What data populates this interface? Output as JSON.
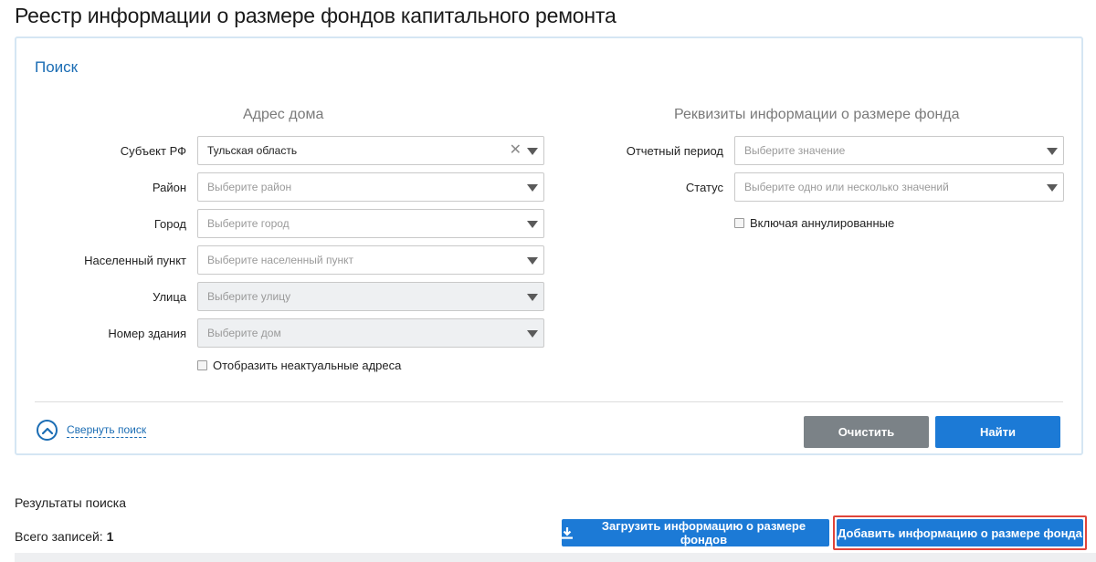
{
  "page": {
    "title": "Реестр информации о размере фондов капитального ремонта"
  },
  "search": {
    "title": "Поиск",
    "address": {
      "heading": "Адрес дома",
      "fields": [
        {
          "label": "Субъект РФ",
          "value": "Тульская область",
          "placeholder": ""
        },
        {
          "label": "Район",
          "value": "",
          "placeholder": "Выберите район"
        },
        {
          "label": "Город",
          "value": "",
          "placeholder": "Выберите город"
        },
        {
          "label": "Населенный пункт",
          "value": "",
          "placeholder": "Выберите населенный пункт"
        },
        {
          "label": "Улица",
          "value": "",
          "placeholder": "Выберите улицу"
        },
        {
          "label": "Номер здания",
          "value": "",
          "placeholder": "Выберите дом"
        }
      ],
      "show_inactive_label": "Отобразить неактуальные адреса"
    },
    "details": {
      "heading": "Реквизиты информации о размере фонда",
      "fields": [
        {
          "label": "Отчетный период",
          "placeholder": "Выберите значение"
        },
        {
          "label": "Статус",
          "placeholder": "Выберите одно или несколько значений"
        }
      ],
      "include_cancelled_label": "Включая аннулированные"
    },
    "collapse_label": "Свернуть поиск",
    "clear_label": "Очистить",
    "find_label": "Найти"
  },
  "results": {
    "title": "Результаты поиска",
    "total_label": "Всего записей:",
    "total_count": "1",
    "upload_label": "Загрузить информацию о размере фондов",
    "add_label": "Добавить информацию о размере фонда"
  },
  "colors": {
    "accent": "#1c7ad6",
    "link": "#1b6db4",
    "highlight": "#e0443a",
    "neutral_button": "#7b8287"
  },
  "icons": {
    "clear": "close-icon",
    "dropdown": "chevron-down-icon",
    "collapse": "chevron-up-circle-icon",
    "upload": "download-icon"
  }
}
